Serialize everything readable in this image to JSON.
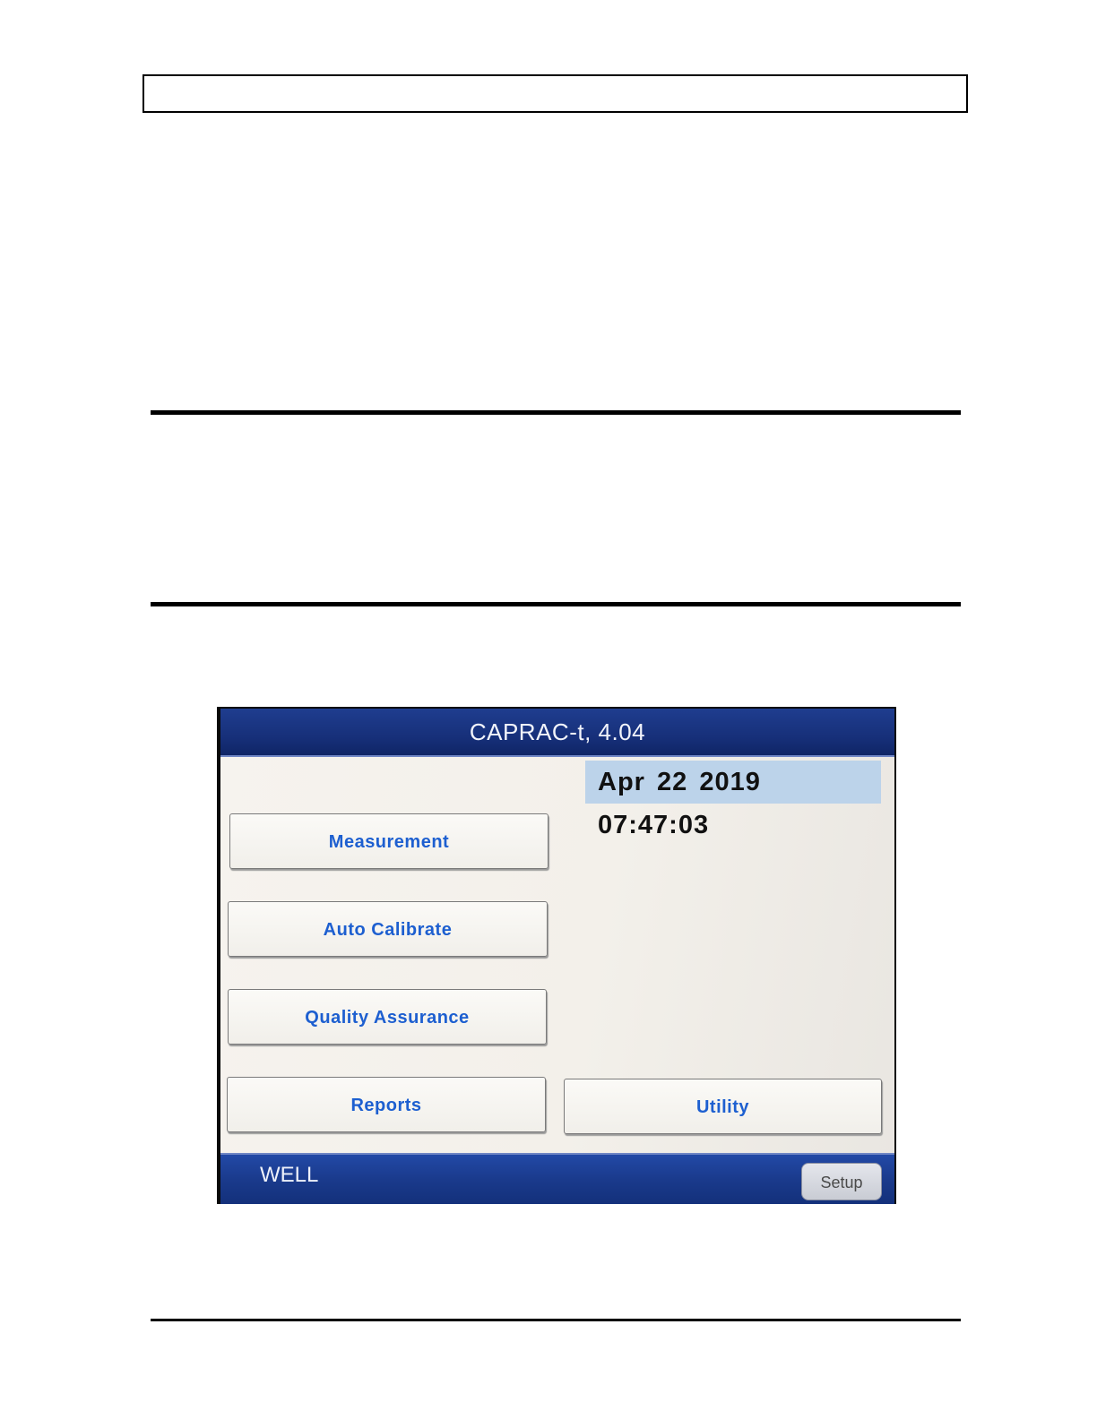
{
  "device_screen": {
    "title": "CAPRAC-t, 4.04",
    "datetime": "Apr 22 2019 07:47:03",
    "buttons": {
      "measurement": "Measurement",
      "auto_calibrate": "Auto Calibrate",
      "quality_assurance": "Quality Assurance",
      "reports": "Reports",
      "utility": "Utility"
    },
    "status": {
      "mode": "WELL",
      "setup_label": "Setup"
    }
  },
  "colors": {
    "bar_blue": "#1a3a8c",
    "button_text": "#1d5fd0",
    "datetime_bg": "#bcd3ea"
  }
}
